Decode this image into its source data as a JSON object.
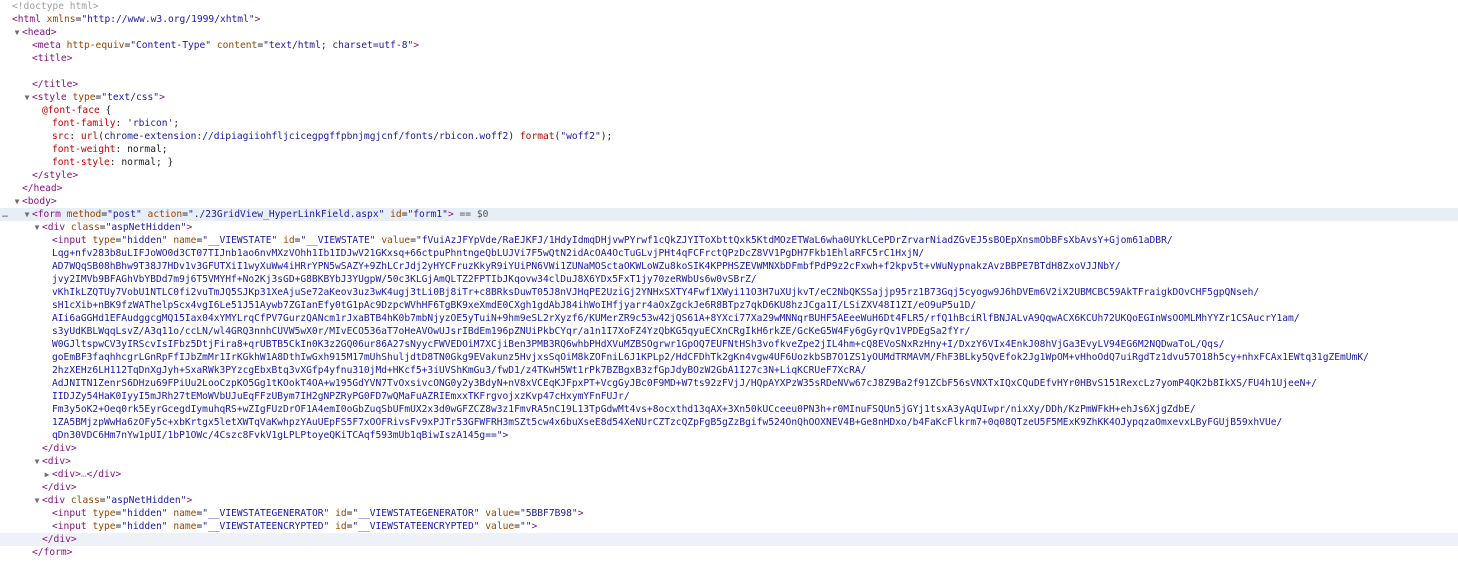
{
  "lines": [
    {
      "indent": 0,
      "kind": "doctype",
      "text": "<!doctype html>"
    },
    {
      "indent": 0,
      "kind": "tag",
      "html": "<span class=\"tag\">&lt;html</span> <span class=\"attr\">xmlns</span>=<span class=\"val\">\"http://www.w3.org/1999/xhtml\"</span><span class=\"tag\">&gt;</span>"
    },
    {
      "indent": 1,
      "twisty": "open",
      "kind": "tag",
      "html": "<span class=\"tag\">&lt;head&gt;</span>"
    },
    {
      "indent": 2,
      "kind": "tag",
      "html": "<span class=\"tag\">&lt;meta</span> <span class=\"attr\">http-equiv</span>=<span class=\"val\">\"Content-Type\"</span> <span class=\"attr\">content</span>=<span class=\"val\">\"text/html; charset=utf-8\"</span><span class=\"tag\">&gt;</span>"
    },
    {
      "indent": 2,
      "kind": "tag",
      "html": "<span class=\"tag\">&lt;title&gt;</span>"
    },
    {
      "indent": 2,
      "kind": "blank",
      "html": ""
    },
    {
      "indent": 2,
      "kind": "tag",
      "html": "<span class=\"tag\">&lt;/title&gt;</span>"
    },
    {
      "indent": 2,
      "twisty": "open",
      "kind": "tag",
      "html": "<span class=\"tag\">&lt;style</span> <span class=\"attr\">type</span>=<span class=\"val\">\"text/css\"</span><span class=\"tag\">&gt;</span>"
    },
    {
      "indent": 3,
      "kind": "css",
      "html": "<span class=\"cssprop\">@font-face</span> {"
    },
    {
      "indent": 4,
      "kind": "css",
      "html": "<span class=\"cssprop\">font-family</span>: <span class=\"cssstr\">'rbicon'</span>;"
    },
    {
      "indent": 4,
      "kind": "css",
      "html": "<span class=\"cssprop\">src</span>: <span class=\"cssfn\">url</span>(<span class=\"cssstr\">chrome-extension://dipiagiiohfljcicegpgffpbnjmgjcnf/fonts/rbicon.woff2</span>) <span class=\"cssfn\">format</span>(<span class=\"cssstr\">\"woff2\"</span>);"
    },
    {
      "indent": 4,
      "kind": "css",
      "html": "<span class=\"cssprop\">font-weight</span>: <span class=\"cssval\">normal</span>;"
    },
    {
      "indent": 4,
      "kind": "css",
      "html": "<span class=\"cssprop\">font-style</span>: <span class=\"cssval\">normal</span>; }"
    },
    {
      "indent": 2,
      "kind": "tag",
      "html": "<span class=\"tag\">&lt;/style&gt;</span>"
    },
    {
      "indent": 1,
      "kind": "tag",
      "html": "<span class=\"tag\">&lt;/head&gt;</span>"
    },
    {
      "indent": 1,
      "twisty": "open",
      "kind": "tag",
      "html": "<span class=\"tag\">&lt;body&gt;</span>"
    },
    {
      "indent": 2,
      "twisty": "open",
      "kind": "tag",
      "selected": true,
      "gutter": "…",
      "html": "<span class=\"tag\">&lt;form</span> <span class=\"attr\">method</span>=<span class=\"val\">\"post\"</span> <span class=\"attr\">action</span>=<span class=\"val\">\"./23GridView_HyperLinkField.aspx\"</span> <span class=\"attr\">id</span>=<span class=\"val\">\"form1\"</span><span class=\"tag\">&gt;</span> <span class=\"eq\">== $0</span>"
    },
    {
      "indent": 3,
      "twisty": "open",
      "kind": "tag",
      "html": "<span class=\"tag\">&lt;div</span> <span class=\"attr\">class</span>=<span class=\"val\">\"aspNetHidden\"</span><span class=\"tag\">&gt;</span>"
    },
    {
      "indent": 4,
      "kind": "tag",
      "html": "<span class=\"tag\">&lt;input</span> <span class=\"attr\">type</span>=<span class=\"val\">\"hidden\"</span> <span class=\"attr\">name</span>=<span class=\"val\">\"__VIEWSTATE\"</span> <span class=\"attr\">id</span>=<span class=\"val\">\"__VIEWSTATE\"</span> <span class=\"attr\">value</span>=<span class=\"val\">\"fVuiAzJFYpVde/RaEJKFJ/1HdyIdmqDHjvwPYrwf1cQkZJYIToXbttQxk5KtdMOzETWaL6wha0UYkLCePDrZrvarNiadZGvEJ5sBOEpXnsmObBFsXbAvsY+Gjom61aDBR/</span>"
    },
    {
      "indent": 4,
      "kind": "vs",
      "text": "Lqg+nfv283b8uLIFJoWO0d3CT07TIJnb1ao6nvMXzVOhh1Ib1IDJwV21GKxsq+66ctpuPhntngeQbLUJVi7F5wQtN2idAcOA4OcTuGLvjPHt4qFCFrctQPzDcZ8VV1PgDH7Fkb1EhlaRFC5rC1HxjN/"
    },
    {
      "indent": 4,
      "kind": "vs",
      "text": "AD7WQqSB08hBhw9T38J7HDv1v3GFUTXiI1wyXuWw4iHRrYPN5wSAZY+9ZhLCrJdj2yHYCFruzKkyR9iYUiPN6VWi1ZUNaMOSctaOKWLoWZu8koSIK4KPPHSZEVWMNXbDFmbfPdP9z2cFxwh+f2kpv5t+vWuNypnakzAvzBBPE7BTdH8ZxoVJJNbY/"
    },
    {
      "indent": 4,
      "kind": "vs",
      "text": "jvy2IMVb9BFAGhVbYBDd7m9j6T5VMYHf+No2Kj3sGD+G8BKBYbJ3YUgpW/50c3KLGjAmQLTZ2FPTIbJKqovw34clDuJ8X6YDx5FxT1jy70zeRWbUs6w0vSBrZ/"
    },
    {
      "indent": 4,
      "kind": "vs",
      "text": "vKhIkLZQTUy7VobU1NTLC0fi2vuTmJQ5SJKp31XeAjuSe72aKeov3uz3wK4ugj3tLi0Bj8iTr+c8BRksDuwT05J8nVJHqPE2UziGj2YNHxSXTY4Fwf1XWyi11O3H7uXUjkvT/eC2NbQKSSajjp95rz1B73Gqj5cyogw9J6hDVEm6V2iX2UBMCBC59AkTFraigkDOvCHF5gpQNseh/"
    },
    {
      "indent": 4,
      "kind": "vs",
      "text": "sH1cXib+nBK9fzWAThelpScx4vgI6Le51J51Aywb7ZGIanEfy0tG1pAc9DzpcWVhHF6TgBK9xeXmdE0CXgh1gdAbJ84ihWoIHfjyarr4aOxZgckJe6R8BTpz7qkD6KU8hzJCga1I/LSiZXV48I1ZI/eO9uP5u1D/"
    },
    {
      "indent": 4,
      "kind": "vs",
      "text": "AIi6aGGHd1EFAudggcgMQ15Iax04xYMYLrqCfPV7GurzQANcm1rJxaBTB4hK0b7mbNjyzOE5yTuiN+9hm9eSL2rXyzf6/KUMerZR9c53w42jQS61A+8YXci77Xa29wMNNqrBUHF5AEeeWuH6Dt4FLR5/rfQ1hBciRlfBNJALvA9QqwACX6KCUh72UKQoEGInWsOOMLMhYYZr1CSAucrY1am/"
    },
    {
      "indent": 4,
      "kind": "vs",
      "text": "s3yUdKBLWqqLsvZ/A3q11o/ccLN/wl4GRQ3nnhCUVW5wX0r/MIvECO536aT7oHeAVOwUJsrIBdEm196pZNUiPkbCYqr/a1n1I7XoFZ4YzQbKG5qyuECXnCRgIkH6rkZE/GcKeG5W4Fy6gGyrQv1VPDEgSa2fYr/"
    },
    {
      "indent": 4,
      "kind": "vs",
      "text": "W0GJltspwCV3yIRScvIsIFbz5DtjFira8+qrUBTB5CkIn0K3z2GQ06ur86A27sNyycFWVEDOiM7XCjiBen3PMB3RQ6whbPHdXVuMZBSOgrwr1GpOQ7EUFNtHSh3vofkveZpe2jIL4hm+cQ8EVoSNxRzHny+I/DxzY6VIx4EnkJ08hVjGa3EvyLV94EG6M2NQDwaToL/Qqs/"
    },
    {
      "indent": 4,
      "kind": "vs",
      "text": "goEmBF3faqhhcgrLGnRpFfIJbZmMr1IrKGkhW1A8DthIwGxh915M17mUhShuljdtD8TN0Gkg9EVakunz5HvjxsSqOiM8kZOFniL6J1KPLp2/HdCFDhTk2gKn4vgw4UF6UozkbSB7O1ZS1yOUMdTRMAVM/FhF3BLky5QvEfok2Jg1WpOM+vHhoOdQ7uiRgdTz1dvu57O18h5cy+nhxFCAx1EWtq31gZEmUmK/"
    },
    {
      "indent": 4,
      "kind": "vs",
      "text": "2hzXEHz6LH112TqDnXgJyh+SxaRWk3PYzcgEbxBtq3vXGfp4yfnu310jMd+HKcf5+3iUVShKmGu3/fwD1/z4TKwH5Wt1rPk7BZBgxB3zfGpJdyBOzW2GbA1I27c3N+LiqKCRUeF7XcRA/"
    },
    {
      "indent": 4,
      "kind": "vs",
      "text": "AdJNITN1ZenrS6DHzu69FPiUu2LooCzpKO5Gg1tKOokT4OA+w195GdYVN7TvOxsivcONG0y2y3BdyN+nV8xVCEqKJFpxPT+VcgGyJBc0F9MD+W7ts92zFVjJ/HQpAYXPzW35sRDeNVw67cJ8Z9Ba2f91ZCbF56sVNXTxIQxCQuDEfvHYr0HBvS151RexcLz7yomP4QK2b8IkXS/FU4h1UjeeN+/"
    },
    {
      "indent": 4,
      "kind": "vs",
      "text": "IIDJZy54HaK0IyyI5mJRh27tEMoWVbUJuEqFFzUBym7IH2gNPZRyPG0FD7wQMaFuAZRIEmxxTKFrgvojxzKvp47cHxymYFnFUJr/"
    },
    {
      "indent": 4,
      "kind": "vs",
      "text": "Fm3y5oK2+Oeq0rk5EyrGcegdIymuhqRS+wZIgFUzDrOF1A4emI0oGbZuqSbUFmUX2x3d0wGFZCZ8w3z1FmvRA5nC19L13TpGdwMt4vs+8ocxthd13qAX+3Xn50kUCceeu0PN3h+r0MInuFSQUn5jGYj1tsxA3yAqUIwpr/nixXy/DDh/KzPmWFkH+ehJs6XjgZdbE/"
    },
    {
      "indent": 4,
      "kind": "vs",
      "text": "1ZA5BMjzpWwHa6zOFy5c+xbKrtgx5letXWTqVaKwhpzYAuUEpFS5F7xOOFRivsFv9xPJTr53GFWFRH3mSZt5cw4x6buXseE8d54XeNUrCZTzcQZpFgB5gZzBgifw524OnQhOOXNEV4B+Ge8nHDxo/b4FaKcFlkrm7+0q08QTzeU5F5MExK9ZhKK4OJypqzaOmxevxLByFGUjB59xhVUe/"
    },
    {
      "indent": 4,
      "kind": "vsend",
      "text": "qDn30VDC6Hm7nYw1pUI/1bP1OWc/4Cszc8FvkV1gLPLPtoyeQKiTCAqf593mUb1qBiwIszA145g==\">"
    },
    {
      "indent": 3,
      "kind": "tag",
      "html": "<span class=\"tag\">&lt;/div&gt;</span>"
    },
    {
      "indent": 3,
      "twisty": "open",
      "kind": "tag",
      "html": "<span class=\"tag\">&lt;div&gt;</span>"
    },
    {
      "indent": 4,
      "twisty": "closed",
      "kind": "tag",
      "html": "<span class=\"tag\">&lt;div&gt;</span><span class=\"muted\">…</span><span class=\"tag\">&lt;/div&gt;</span>"
    },
    {
      "indent": 3,
      "kind": "tag",
      "html": "<span class=\"tag\">&lt;/div&gt;</span>"
    },
    {
      "indent": 3,
      "twisty": "open",
      "kind": "tag",
      "html": "<span class=\"tag\">&lt;div</span> <span class=\"attr\">class</span>=<span class=\"val\">\"aspNetHidden\"</span><span class=\"tag\">&gt;</span>"
    },
    {
      "indent": 4,
      "kind": "tag",
      "html": "<span class=\"tag\">&lt;input</span> <span class=\"attr\">type</span>=<span class=\"val\">\"hidden\"</span> <span class=\"attr\">name</span>=<span class=\"val\">\"__VIEWSTATEGENERATOR\"</span> <span class=\"attr\">id</span>=<span class=\"val\">\"__VIEWSTATEGENERATOR\"</span> <span class=\"attr\">value</span>=<span class=\"val\">\"5BBF7B98\"</span><span class=\"tag\">&gt;</span>"
    },
    {
      "indent": 4,
      "kind": "tag",
      "html": "<span class=\"tag\">&lt;input</span> <span class=\"attr\">type</span>=<span class=\"val\">\"hidden\"</span> <span class=\"attr\">name</span>=<span class=\"val\">\"__VIEWSTATEENCRYPTED\"</span> <span class=\"attr\">id</span>=<span class=\"val\">\"__VIEWSTATEENCRYPTED\"</span> <span class=\"attr\">value</span>=<span class=\"val\">\"\"</span><span class=\"tag\">&gt;</span>"
    },
    {
      "indent": 3,
      "kind": "tag",
      "hover": true,
      "html": "<span class=\"tag\">&lt;/div&gt;</span>"
    },
    {
      "indent": 2,
      "kind": "tag",
      "html": "<span class=\"tag\">&lt;/form&gt;</span>"
    }
  ]
}
